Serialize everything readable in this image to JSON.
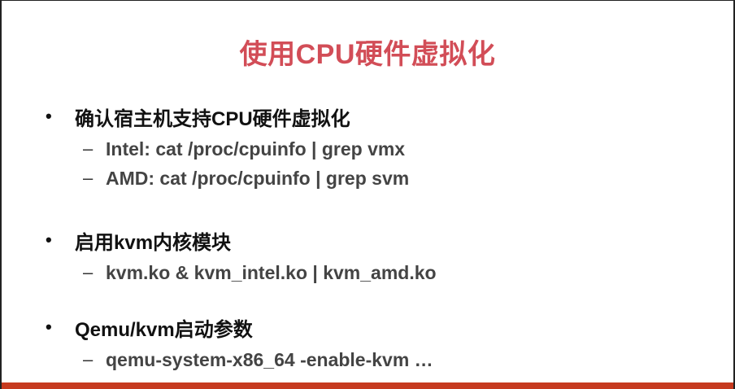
{
  "slide": {
    "title": "使用CPU硬件虚拟化",
    "bullets": [
      {
        "marker": "•",
        "text": "确认宿主机支持CPU硬件虚拟化",
        "subs": [
          {
            "marker": "–",
            "text": "Intel: cat /proc/cpuinfo | grep vmx"
          },
          {
            "marker": "–",
            "text": "AMD: cat /proc/cpuinfo | grep svm"
          }
        ]
      },
      {
        "marker": "•",
        "text": "启用kvm内核模块",
        "subs": [
          {
            "marker": "–",
            "text": "kvm.ko & kvm_intel.ko | kvm_amd.ko"
          }
        ]
      },
      {
        "marker": "•",
        "text": "Qemu/kvm启动参数",
        "subs": [
          {
            "marker": "–",
            "text": "qemu-system-x86_64 -enable-kvm …"
          }
        ]
      }
    ],
    "colors": {
      "title": "#d24d57",
      "accent_bar": "#c63a1f",
      "text": "#111111",
      "sub_text": "#444444"
    }
  }
}
